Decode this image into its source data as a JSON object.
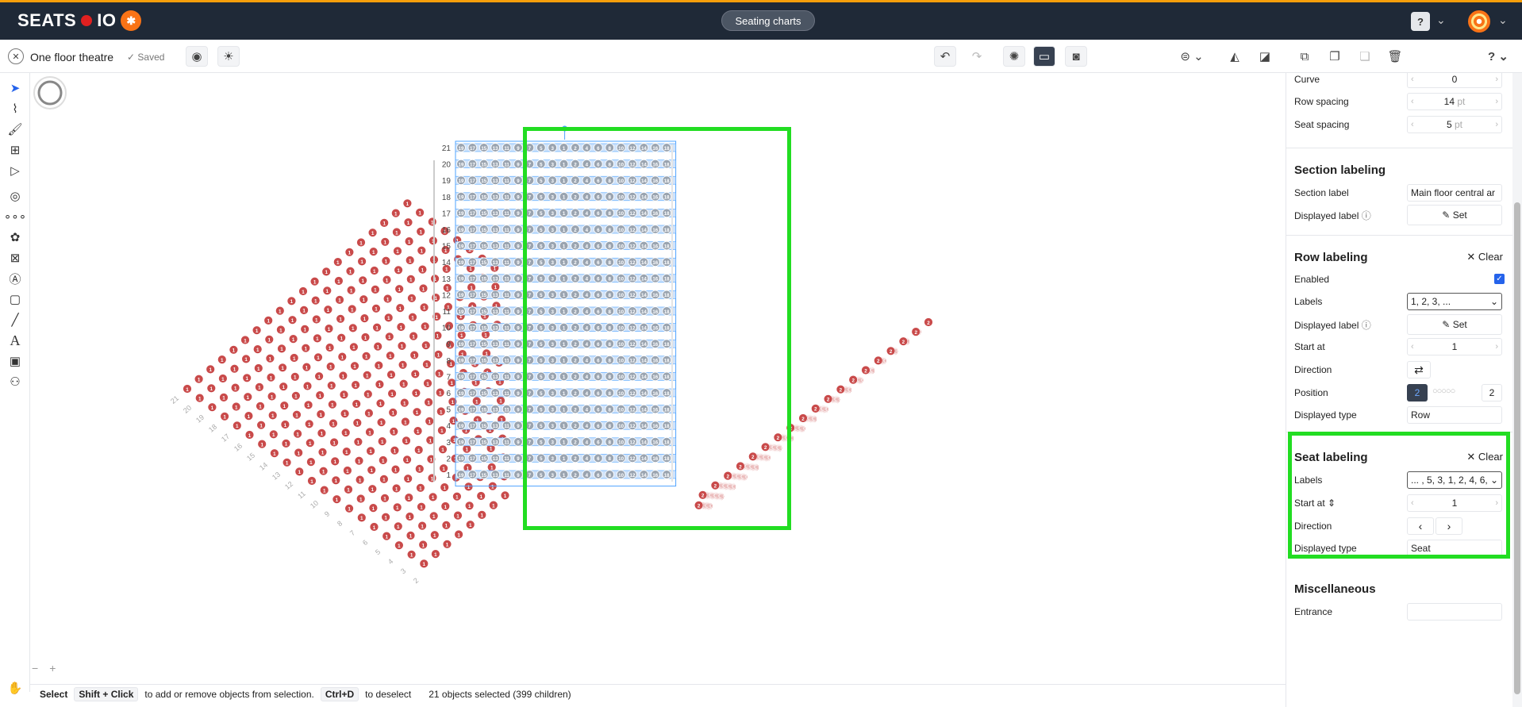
{
  "app": {
    "brand_left": "SEATS",
    "brand_right": "IO",
    "center_tab": "Seating charts",
    "help": "?"
  },
  "toolbar": {
    "chart_name": "One floor theatre",
    "saved": "Saved"
  },
  "status": {
    "mode": "Select",
    "shift_key": "Shift + Click",
    "shift_text": "to add or remove objects from selection.",
    "ctrl_key": "Ctrl+D",
    "ctrl_text": "to deselect",
    "selection": "21 objects selected (399 children)"
  },
  "panel": {
    "curve": {
      "label": "Curve",
      "value": "0"
    },
    "row_spacing": {
      "label": "Row spacing",
      "value": "14",
      "unit": "pt"
    },
    "seat_spacing": {
      "label": "Seat spacing",
      "value": "5",
      "unit": "pt"
    },
    "section_labeling": {
      "title": "Section labeling",
      "section_label": "Section label",
      "section_value": "Main floor central ar",
      "displayed_label": "Displayed label",
      "set": "Set"
    },
    "row_labeling": {
      "title": "Row labeling",
      "clear": "Clear",
      "enabled": "Enabled",
      "labels": "Labels",
      "labels_value": "1, 2, 3, ...",
      "displayed_label": "Displayed label",
      "set": "Set",
      "start_at": "Start at",
      "start_value": "1",
      "direction": "Direction",
      "position": "Position",
      "position_left": "2",
      "position_right": "2",
      "displayed_type": "Displayed type",
      "type_value": "Row"
    },
    "seat_labeling": {
      "title": "Seat labeling",
      "clear": "Clear",
      "labels": "Labels",
      "labels_value": "... , 5, 3, 1, 2, 4, 6, ...",
      "start_at": "Start at",
      "start_value": "1",
      "direction": "Direction",
      "displayed_type": "Displayed type",
      "type_value": "Seat"
    },
    "misc": {
      "title": "Miscellaneous",
      "entrance": "Entrance"
    }
  },
  "chart_data": {
    "center_rows": [
      "21",
      "20",
      "19",
      "18",
      "17",
      "16",
      "15",
      "14",
      "13",
      "12",
      "11",
      "10",
      "9",
      "8",
      "7",
      "6",
      "5",
      "4",
      "3",
      "2",
      "1"
    ],
    "center_seat_labels": [
      "19",
      "17",
      "15",
      "13",
      "11",
      "9",
      "7",
      "5",
      "3",
      "1",
      "2",
      "4",
      "6",
      "8",
      "10",
      "12",
      "14",
      "16",
      "18"
    ],
    "left_section_row_labels": [
      "21",
      "20",
      "19",
      "18",
      "17",
      "16",
      "15",
      "14",
      "13",
      "12",
      "11",
      "10",
      "9",
      "8",
      "7",
      "6",
      "5",
      "4",
      "3",
      "2"
    ],
    "left_seat_label": "1",
    "right_seat_label": "2",
    "colors": {
      "seat_red": "#c94a4a",
      "seat_selected": "#9aa4b0",
      "selection": "#4ea3ff",
      "highlight": "#22dd22"
    }
  }
}
